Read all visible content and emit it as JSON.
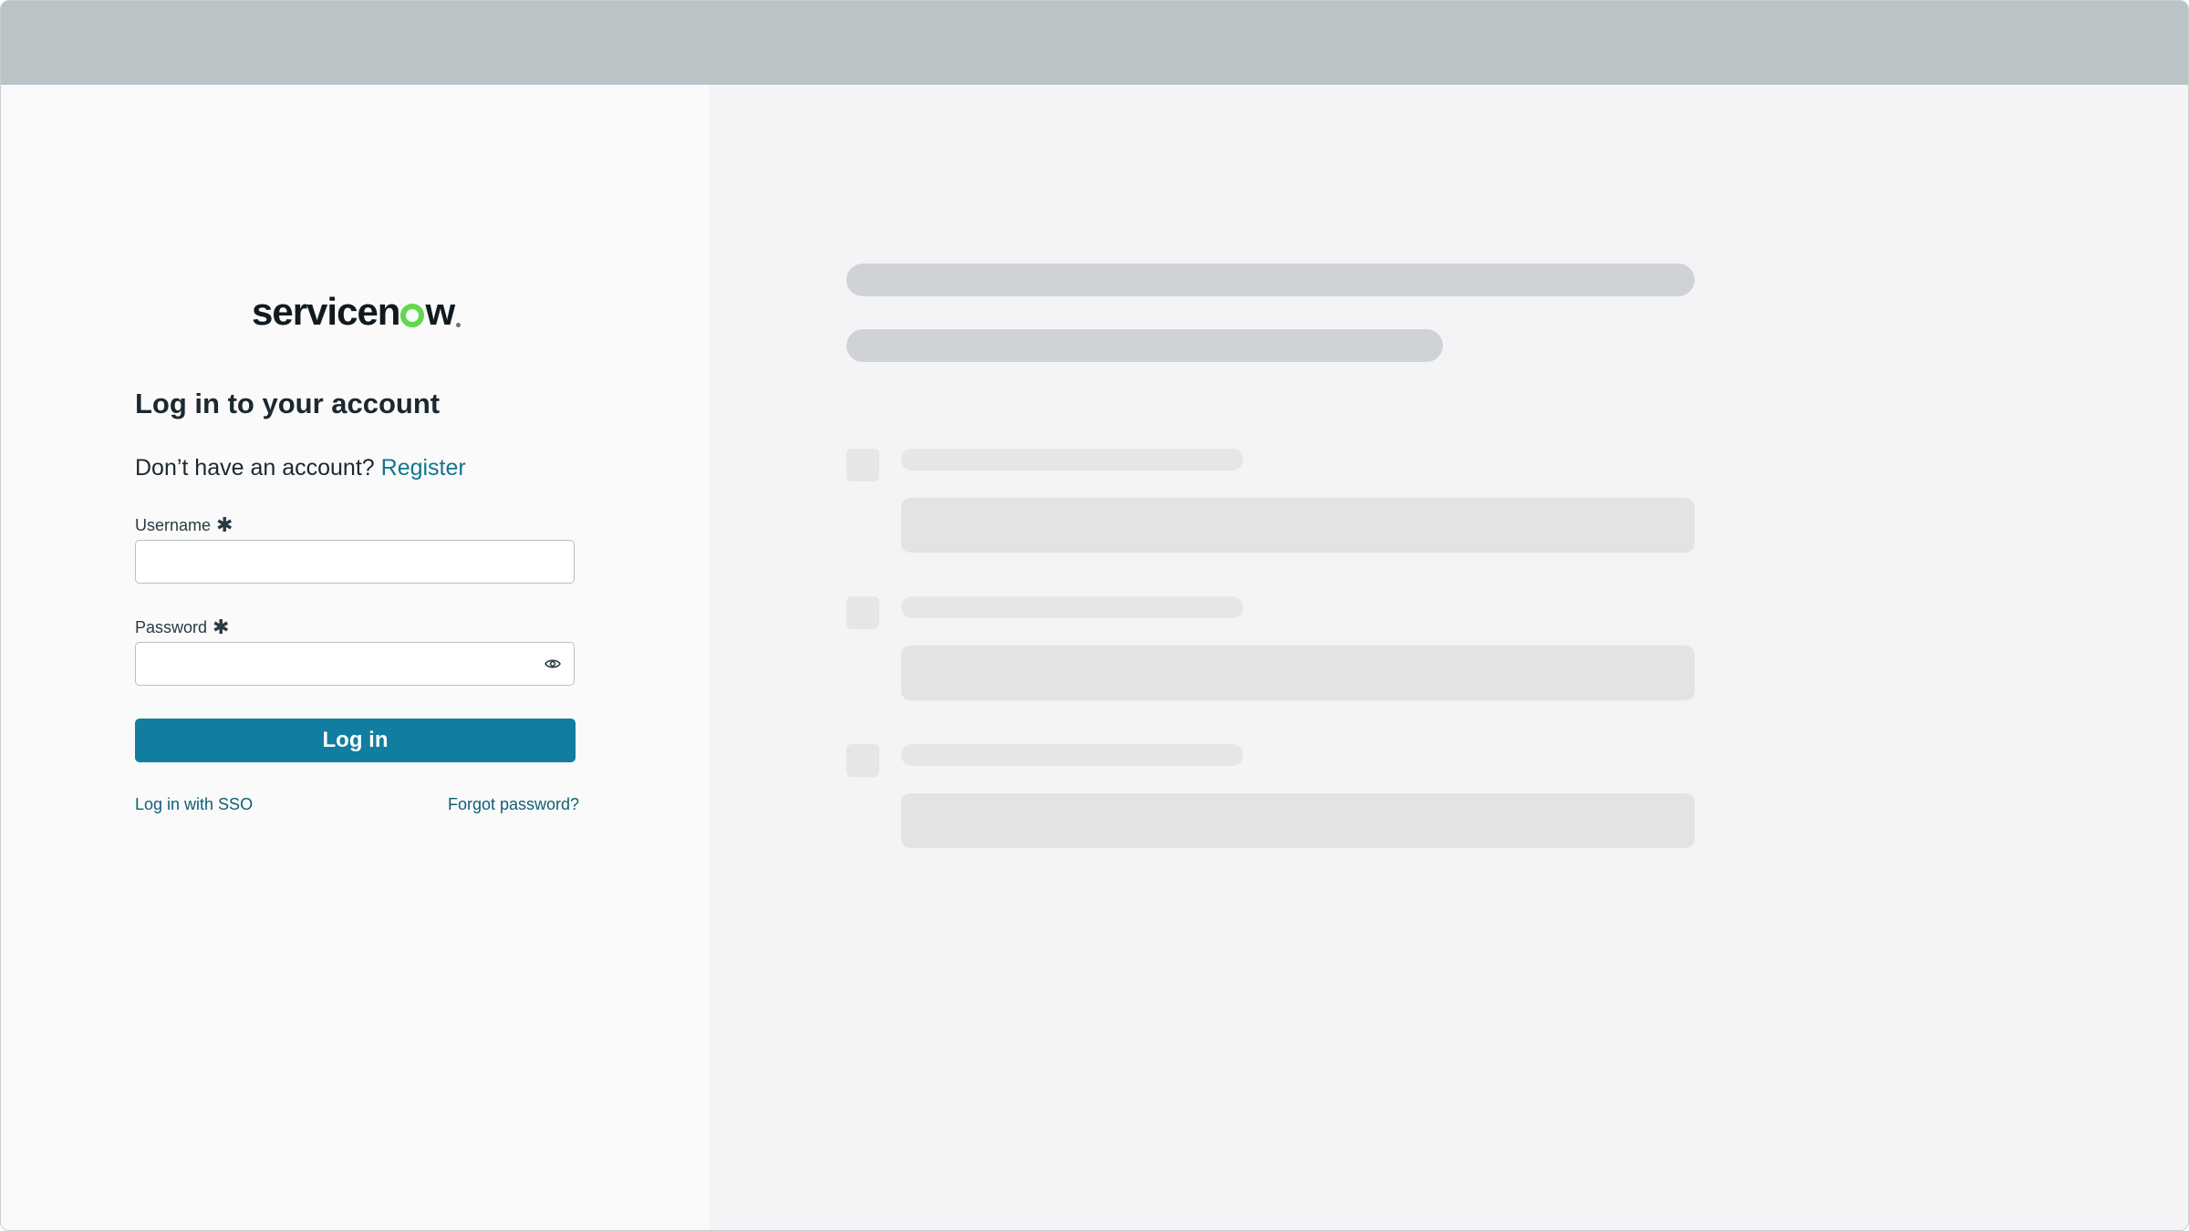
{
  "brand": {
    "logo_text_before": "servicen",
    "logo_text_after": "w"
  },
  "login": {
    "heading": "Log in to your account",
    "no_account_text": "Don’t have an account?",
    "register_link": "Register",
    "username_label": "Username",
    "password_label": "Password",
    "required_marker": "✱",
    "username_value": "",
    "password_value": "",
    "login_button": "Log in",
    "sso_link": "Log in with SSO",
    "forgot_link": "Forgot password?"
  },
  "icons": {
    "password_toggle": "eye-icon"
  },
  "colors": {
    "primary_button": "#117da0",
    "link": "#14758f",
    "logo_accent": "#62d84e",
    "top_bar": "#bcc3c6"
  }
}
